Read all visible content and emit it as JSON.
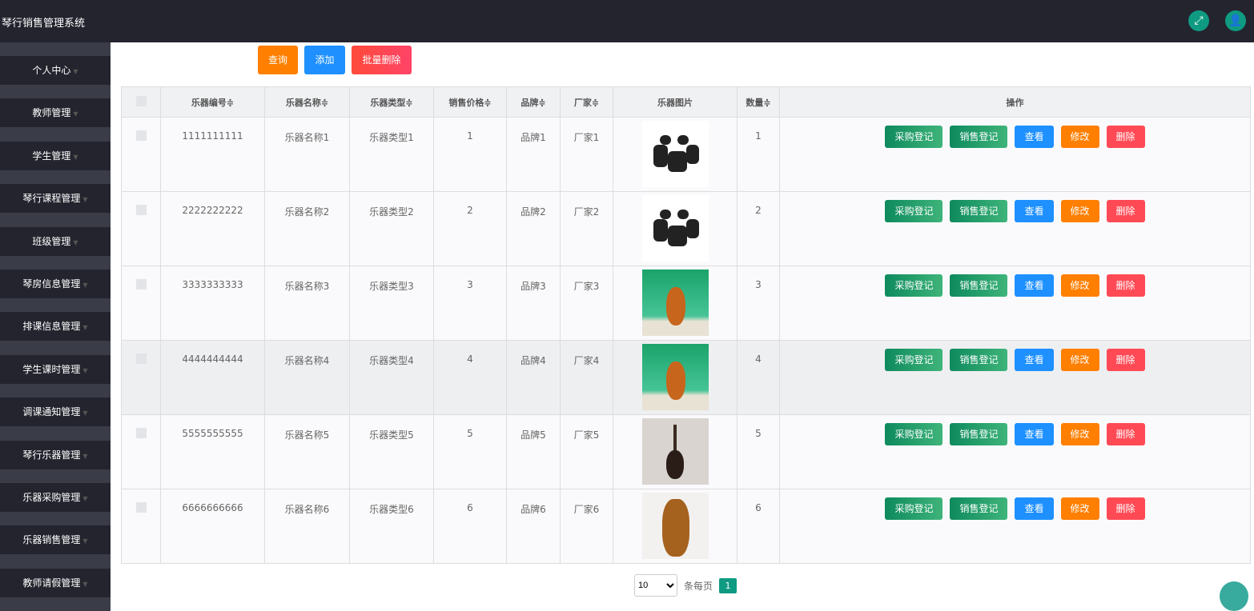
{
  "app_title": "琴行销售管理系统",
  "topbar_icons": [
    "fullscreen-icon",
    "user-icon"
  ],
  "sidebar": [
    "个人中心",
    "教师管理",
    "学生管理",
    "琴行课程管理",
    "班级管理",
    "琴房信息管理",
    "排课信息管理",
    "学生课时管理",
    "调课通知管理",
    "琴行乐器管理",
    "乐器采购管理",
    "乐器销售管理",
    "教师请假管理"
  ],
  "toolbar": {
    "search": "查询",
    "add": "添加",
    "batch_delete": "批量删除"
  },
  "columns": [
    "乐器编号",
    "乐器名称",
    "乐器类型",
    "销售价格",
    "品牌",
    "厂家",
    "乐器图片",
    "数量",
    "操作"
  ],
  "sortable_suffix": "≑",
  "actions": {
    "purchase": "采购登记",
    "sale": "销售登记",
    "view": "查看",
    "edit": "修改",
    "delete": "删除"
  },
  "rows": [
    {
      "id": "1111111111",
      "name": "乐器名称1",
      "type": "乐器类型1",
      "price": "1",
      "brand": "品牌1",
      "maker": "厂家1",
      "image": "drum-kit",
      "qty": "1"
    },
    {
      "id": "2222222222",
      "name": "乐器名称2",
      "type": "乐器类型2",
      "price": "2",
      "brand": "品牌2",
      "maker": "厂家2",
      "image": "drum-kit",
      "qty": "2"
    },
    {
      "id": "3333333333",
      "name": "乐器名称3",
      "type": "乐器类型3",
      "price": "3",
      "brand": "品牌3",
      "maker": "厂家3",
      "image": "violin",
      "qty": "3"
    },
    {
      "id": "4444444444",
      "name": "乐器名称4",
      "type": "乐器类型4",
      "price": "4",
      "brand": "品牌4",
      "maker": "厂家4",
      "image": "violin",
      "qty": "4"
    },
    {
      "id": "5555555555",
      "name": "乐器名称5",
      "type": "乐器类型5",
      "price": "5",
      "brand": "品牌5",
      "maker": "厂家5",
      "image": "guitar",
      "qty": "5"
    },
    {
      "id": "6666666666",
      "name": "乐器名称6",
      "type": "乐器类型6",
      "price": "6",
      "brand": "品牌6",
      "maker": "厂家6",
      "image": "violin-brown",
      "qty": "6"
    }
  ],
  "pager": {
    "page_size": "10",
    "per_page_label": "条每页",
    "current_page": "1"
  }
}
